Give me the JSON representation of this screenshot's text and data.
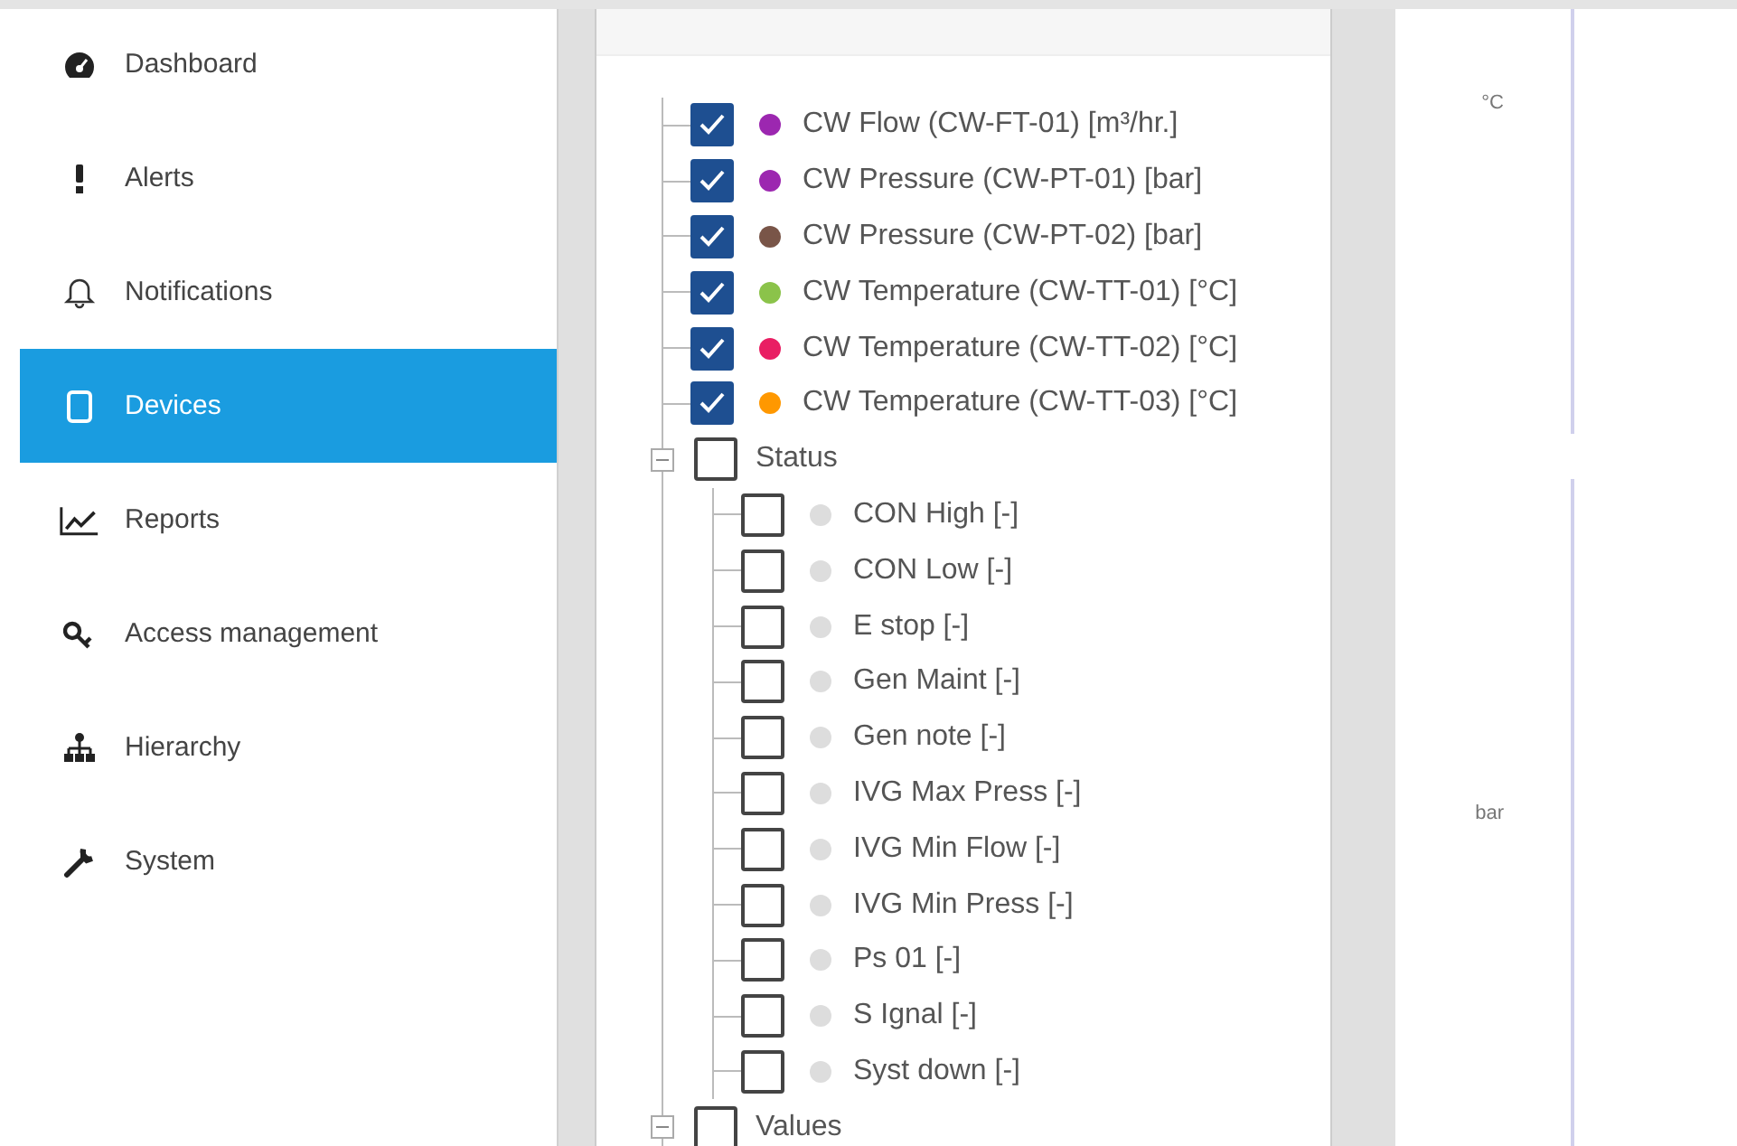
{
  "sidebar": {
    "items": [
      {
        "label": "Dashboard",
        "selected": false
      },
      {
        "label": "Alerts",
        "selected": false
      },
      {
        "label": "Notifications",
        "selected": false
      },
      {
        "label": "Devices",
        "selected": true
      },
      {
        "label": "Reports",
        "selected": false
      },
      {
        "label": "Access management",
        "selected": false
      },
      {
        "label": "Hierarchy",
        "selected": false
      },
      {
        "label": "System",
        "selected": false
      }
    ]
  },
  "tree": {
    "nodes": [
      {
        "label": "CW Flow (CW-FT-01) [m³/hr.]",
        "checked": true,
        "color": "#9c27b0"
      },
      {
        "label": "CW Pressure (CW-PT-01) [bar]",
        "checked": true,
        "color": "#9c27b0"
      },
      {
        "label": "CW Pressure (CW-PT-02) [bar]",
        "checked": true,
        "color": "#795548"
      },
      {
        "label": "CW Temperature (CW-TT-01) [°C]",
        "checked": true,
        "color": "#8bc34a"
      },
      {
        "label": "CW Temperature (CW-TT-02) [°C]",
        "checked": true,
        "color": "#e91e63"
      },
      {
        "label": "CW Temperature (CW-TT-03) [°C]",
        "checked": true,
        "color": "#ff9800"
      },
      {
        "label": "Status",
        "checked": false,
        "expanded": true,
        "children": [
          {
            "label": "CON High [-]",
            "checked": false,
            "color": "#dddddd"
          },
          {
            "label": "CON Low [-]",
            "checked": false,
            "color": "#dddddd"
          },
          {
            "label": "E stop [-]",
            "checked": false,
            "color": "#dddddd"
          },
          {
            "label": "Gen Maint [-]",
            "checked": false,
            "color": "#dddddd"
          },
          {
            "label": "Gen note [-]",
            "checked": false,
            "color": "#dddddd"
          },
          {
            "label": "IVG Max Press [-]",
            "checked": false,
            "color": "#dddddd"
          },
          {
            "label": "IVG Min Flow [-]",
            "checked": false,
            "color": "#dddddd"
          },
          {
            "label": "IVG Min Press [-]",
            "checked": false,
            "color": "#dddddd"
          },
          {
            "label": "Ps 01 [-]",
            "checked": false,
            "color": "#dddddd"
          },
          {
            "label": "S Ignal [-]",
            "checked": false,
            "color": "#dddddd"
          },
          {
            "label": "Syst down [-]",
            "checked": false,
            "color": "#dddddd"
          }
        ]
      },
      {
        "label": "Values",
        "checked": false,
        "expanded": true
      }
    ]
  },
  "chart": {
    "axes": [
      {
        "unit": "°C"
      },
      {
        "unit": "bar"
      }
    ]
  }
}
